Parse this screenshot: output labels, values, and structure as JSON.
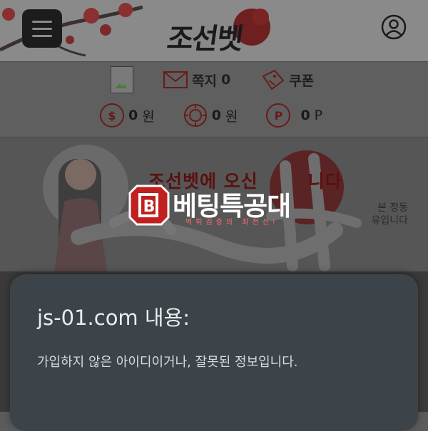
{
  "header": {
    "logo_text": "조선벳",
    "menu_icon": "hamburger-menu-icon",
    "user_icon": "user-profile-icon"
  },
  "info": {
    "message_label": "쪽지",
    "message_count": "0",
    "coupon_label": "쿠폰",
    "cash_value": "0",
    "cash_unit": "원",
    "casino_value": "0",
    "casino_unit": "원",
    "point_value": "0",
    "point_unit": "P",
    "cash_icon_glyph": "$",
    "point_icon_glyph": "P"
  },
  "banner": {
    "headline": "조선벳에 오신",
    "headline_end": "니다",
    "sub_line1": "본 정동",
    "sub_line2": "유입니다",
    "overlay_title": "베팅특공대",
    "overlay_sub": "먹튀검증의 최전선!",
    "overlay_badge": "B"
  },
  "dialog": {
    "title": "js-01.com 내용:",
    "message": "가입하지 않은 아이디이거나, 잘못된 정보입니다."
  },
  "colors": {
    "accent_red": "#c0201f",
    "dialog_bg": "#3d4449"
  }
}
